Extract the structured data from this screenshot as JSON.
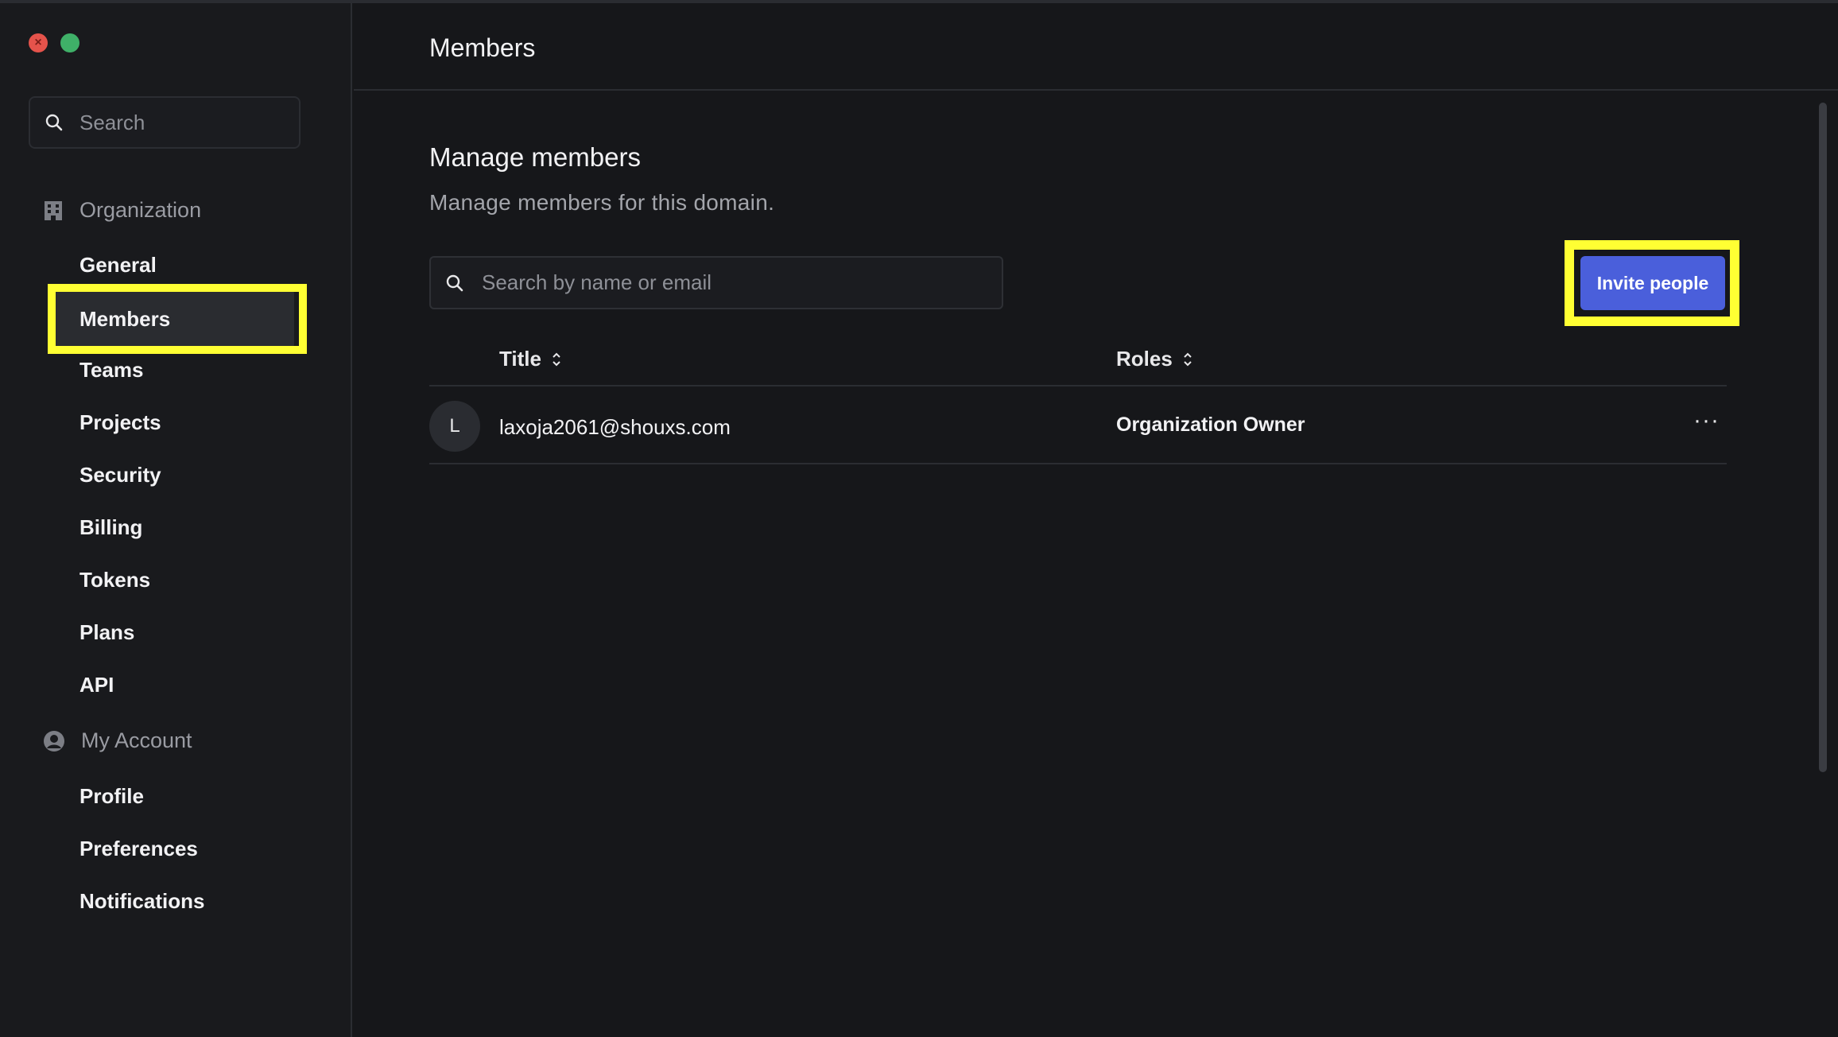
{
  "sidebar": {
    "search_placeholder": "Search",
    "organization": {
      "label": "Organization",
      "items": [
        "General",
        "Members",
        "Teams",
        "Projects",
        "Security",
        "Billing",
        "Tokens",
        "Plans",
        "API"
      ]
    },
    "account": {
      "label": "My Account",
      "items": [
        "Profile",
        "Preferences",
        "Notifications"
      ]
    },
    "active_item": "Members"
  },
  "main": {
    "page_title": "Members",
    "section_title": "Manage members",
    "section_subtitle": "Manage members for this domain.",
    "search_placeholder": "Search by name or email",
    "invite_label": "Invite people",
    "columns": [
      "Title",
      "Roles"
    ],
    "members": [
      {
        "initial": "L",
        "email": "laxoja2061@shouxs.com",
        "role": "Organization Owner"
      }
    ],
    "row_menu": "···"
  },
  "colors": {
    "accent": "#4a5fdb",
    "highlight": "#ffff33",
    "background": "#16171a",
    "sidebar": "#191a1d"
  },
  "icons": [
    "search-icon",
    "building-icon",
    "user-circle-icon",
    "sort-icon",
    "more-icon"
  ]
}
